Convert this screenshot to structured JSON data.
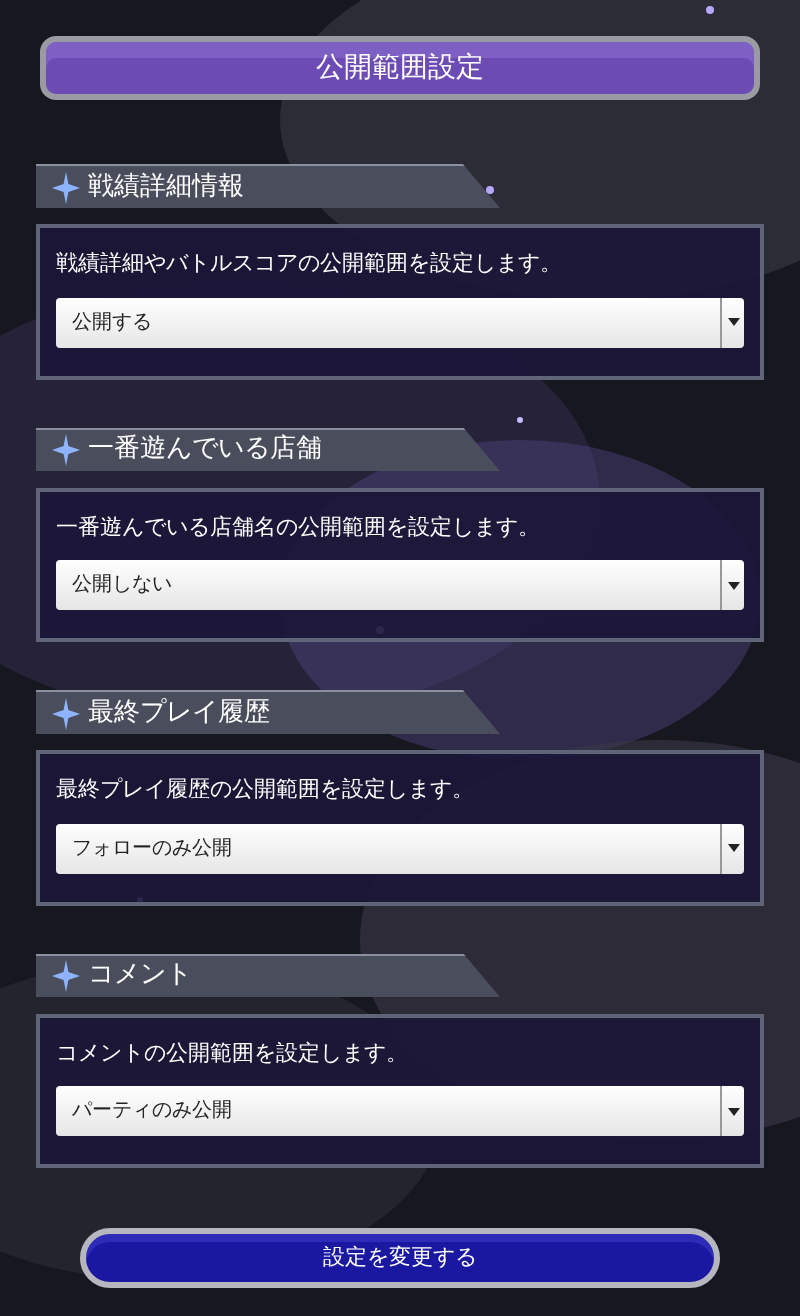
{
  "title": "公開範囲設定",
  "sections": [
    {
      "heading": "戦績詳細情報",
      "description": "戦績詳細やバトルスコアの公開範囲を設定します。",
      "value": "公開する"
    },
    {
      "heading": "一番遊んでいる店舗",
      "description": "一番遊んでいる店舗名の公開範囲を設定します。",
      "value": "公開しない"
    },
    {
      "heading": "最終プレイ履歴",
      "description": "最終プレイ履歴の公開範囲を設定します。",
      "value": "フォローのみ公開"
    },
    {
      "heading": "コメント",
      "description": "コメントの公開範囲を設定します。",
      "value": "パーティのみ公開"
    }
  ],
  "submit": "設定を変更する"
}
